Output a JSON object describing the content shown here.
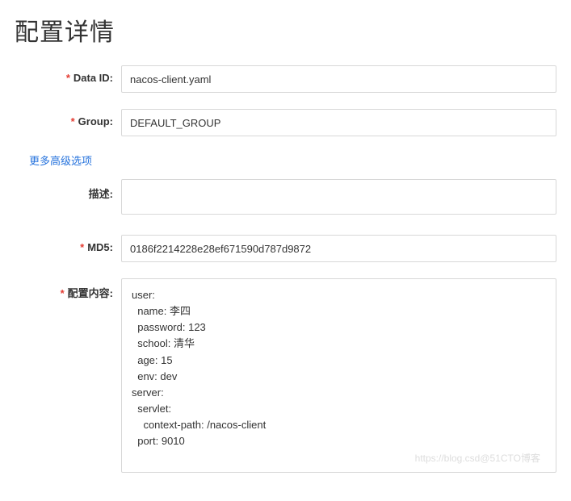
{
  "title": "配置详情",
  "labels": {
    "dataId": "Data ID:",
    "group": "Group:",
    "advanced": "更多高级选项",
    "description": "描述:",
    "md5": "MD5:",
    "content": "配置内容:"
  },
  "values": {
    "dataId": "nacos-client.yaml",
    "group": "DEFAULT_GROUP",
    "description": "",
    "md5": "0186f2214228e28ef671590d787d9872",
    "content": "user:\n  name: 李四\n  password: 123\n  school: 清华\n  age: 15\n  env: dev\nserver:\n  servlet:\n    context-path: /nacos-client\n  port: 9010"
  },
  "watermark": "https://blog.csd@51CTO博客"
}
